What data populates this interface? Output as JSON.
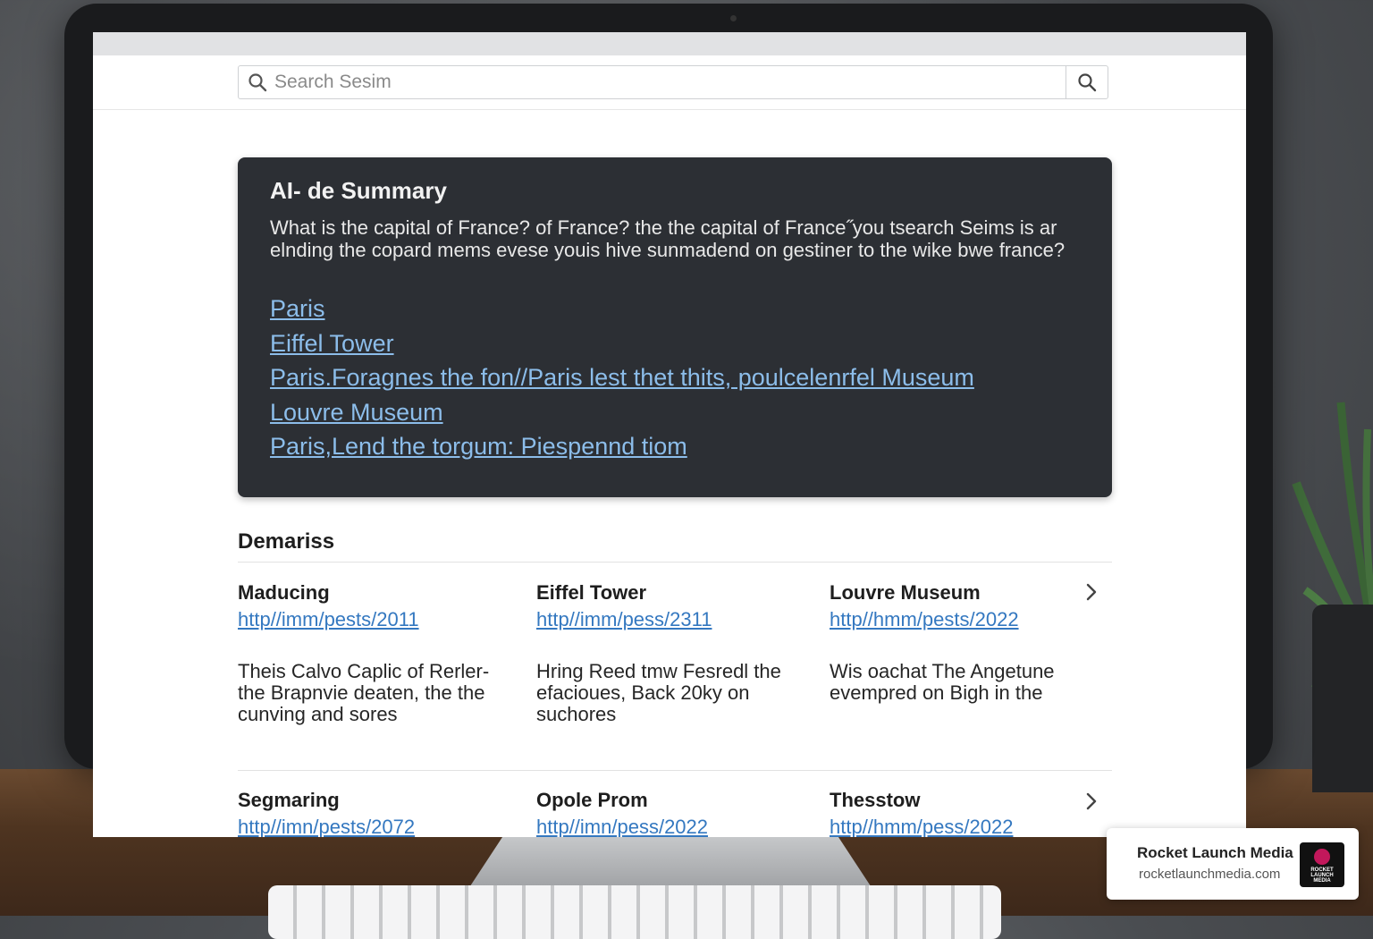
{
  "search": {
    "placeholder": "Search Sesim"
  },
  "ai_summary": {
    "title": "AI- de Summary",
    "text": "What is the capital of France? of France? the the capital of France˝you tsearch Seims is ar elnding the copard mems evese youis hive sunmadend on gestiner to the wike bwe france?",
    "links": [
      "Paris",
      "Eiffel Tower",
      "Paris.Foragnes the fon//Paris lest thet thits, poulcelenrfel Museum",
      "Louvre Museum",
      "Paris,Lend the torgum: Piespennd tiom"
    ]
  },
  "results": {
    "section_title": "Demariss",
    "row1": [
      {
        "title": "Maducing",
        "url": "http//imm/pests/2011",
        "snippet": "Theis Calvo Caplic of Rerler- the Brapnvie deaten, the the cunving and sores"
      },
      {
        "title": "Eiffel Tower",
        "url": "http//imm/pess/2311",
        "snippet": "Hring Reed tmw Fesredl the efacioues, Back 20ky on suchores"
      },
      {
        "title": "Louvre Museum",
        "url": "http//hmm/pests/2022",
        "snippet": "Wis oachat The Angetune evempred on Bigh in the"
      }
    ],
    "row2": [
      {
        "title": "Segmaring",
        "url": "http//imn/pests/2072"
      },
      {
        "title": "Opole Prom",
        "url": "http//imn/pess/2022"
      },
      {
        "title": "Thesstow",
        "url": "http//hmm/pess/2022"
      }
    ]
  },
  "badge": {
    "name": "Rocket Launch Media",
    "url": "rocketlaunchmedia.com",
    "logo_line1": "ROCKET",
    "logo_line2": "LAUNCH",
    "logo_line3": "MEDIA"
  },
  "colors": {
    "ai_card_bg": "#2c2f34",
    "link_on_dark": "#8cbdea",
    "link": "#3478c0"
  }
}
